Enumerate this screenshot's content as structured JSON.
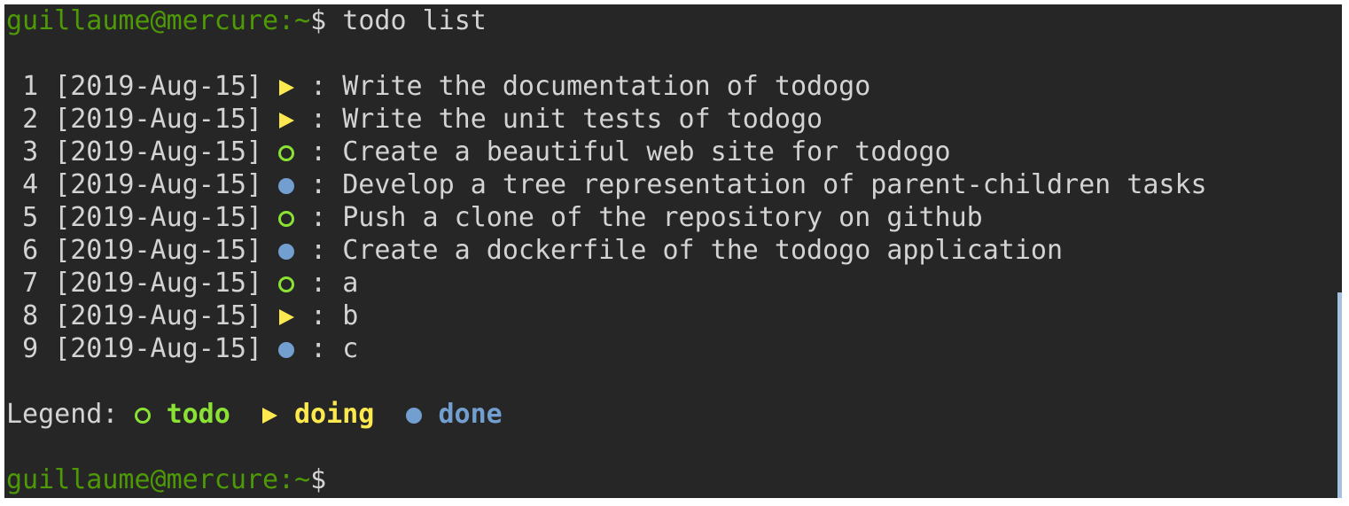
{
  "prompt": {
    "user_host": "guillaume@mercure",
    "cwd": ":~",
    "symbol": "$",
    "command": " todo list"
  },
  "tasks": [
    {
      "num": "1",
      "date": "[2019-Aug-15]",
      "status": "doing",
      "text": "Write the documentation of todogo"
    },
    {
      "num": "2",
      "date": "[2019-Aug-15]",
      "status": "doing",
      "text": "Write the unit tests of todogo"
    },
    {
      "num": "3",
      "date": "[2019-Aug-15]",
      "status": "todo",
      "text": "Create a beautiful web site for todogo"
    },
    {
      "num": "4",
      "date": "[2019-Aug-15]",
      "status": "done",
      "text": "Develop a tree representation of parent-children tasks"
    },
    {
      "num": "5",
      "date": "[2019-Aug-15]",
      "status": "todo",
      "text": "Push a clone of the repository on github"
    },
    {
      "num": "6",
      "date": "[2019-Aug-15]",
      "status": "done",
      "text": "Create a dockerfile of the todogo application"
    },
    {
      "num": "7",
      "date": "[2019-Aug-15]",
      "status": "todo",
      "text": "a"
    },
    {
      "num": "8",
      "date": "[2019-Aug-15]",
      "status": "doing",
      "text": "b"
    },
    {
      "num": "9",
      "date": "[2019-Aug-15]",
      "status": "done",
      "text": "c"
    }
  ],
  "separator": " : ",
  "legend": {
    "label": "Legend:",
    "todo": "todo",
    "doing": "doing",
    "done": "done"
  },
  "icons": {
    "todo": "open-circle-icon",
    "doing": "triangle-right-icon",
    "done": "filled-circle-icon"
  },
  "colors": {
    "background": "#262626",
    "text": "#d3d3d3",
    "prompt": "#4e9a06",
    "todo": "#8ae234",
    "doing": "#fce94f",
    "done": "#729fcf"
  }
}
